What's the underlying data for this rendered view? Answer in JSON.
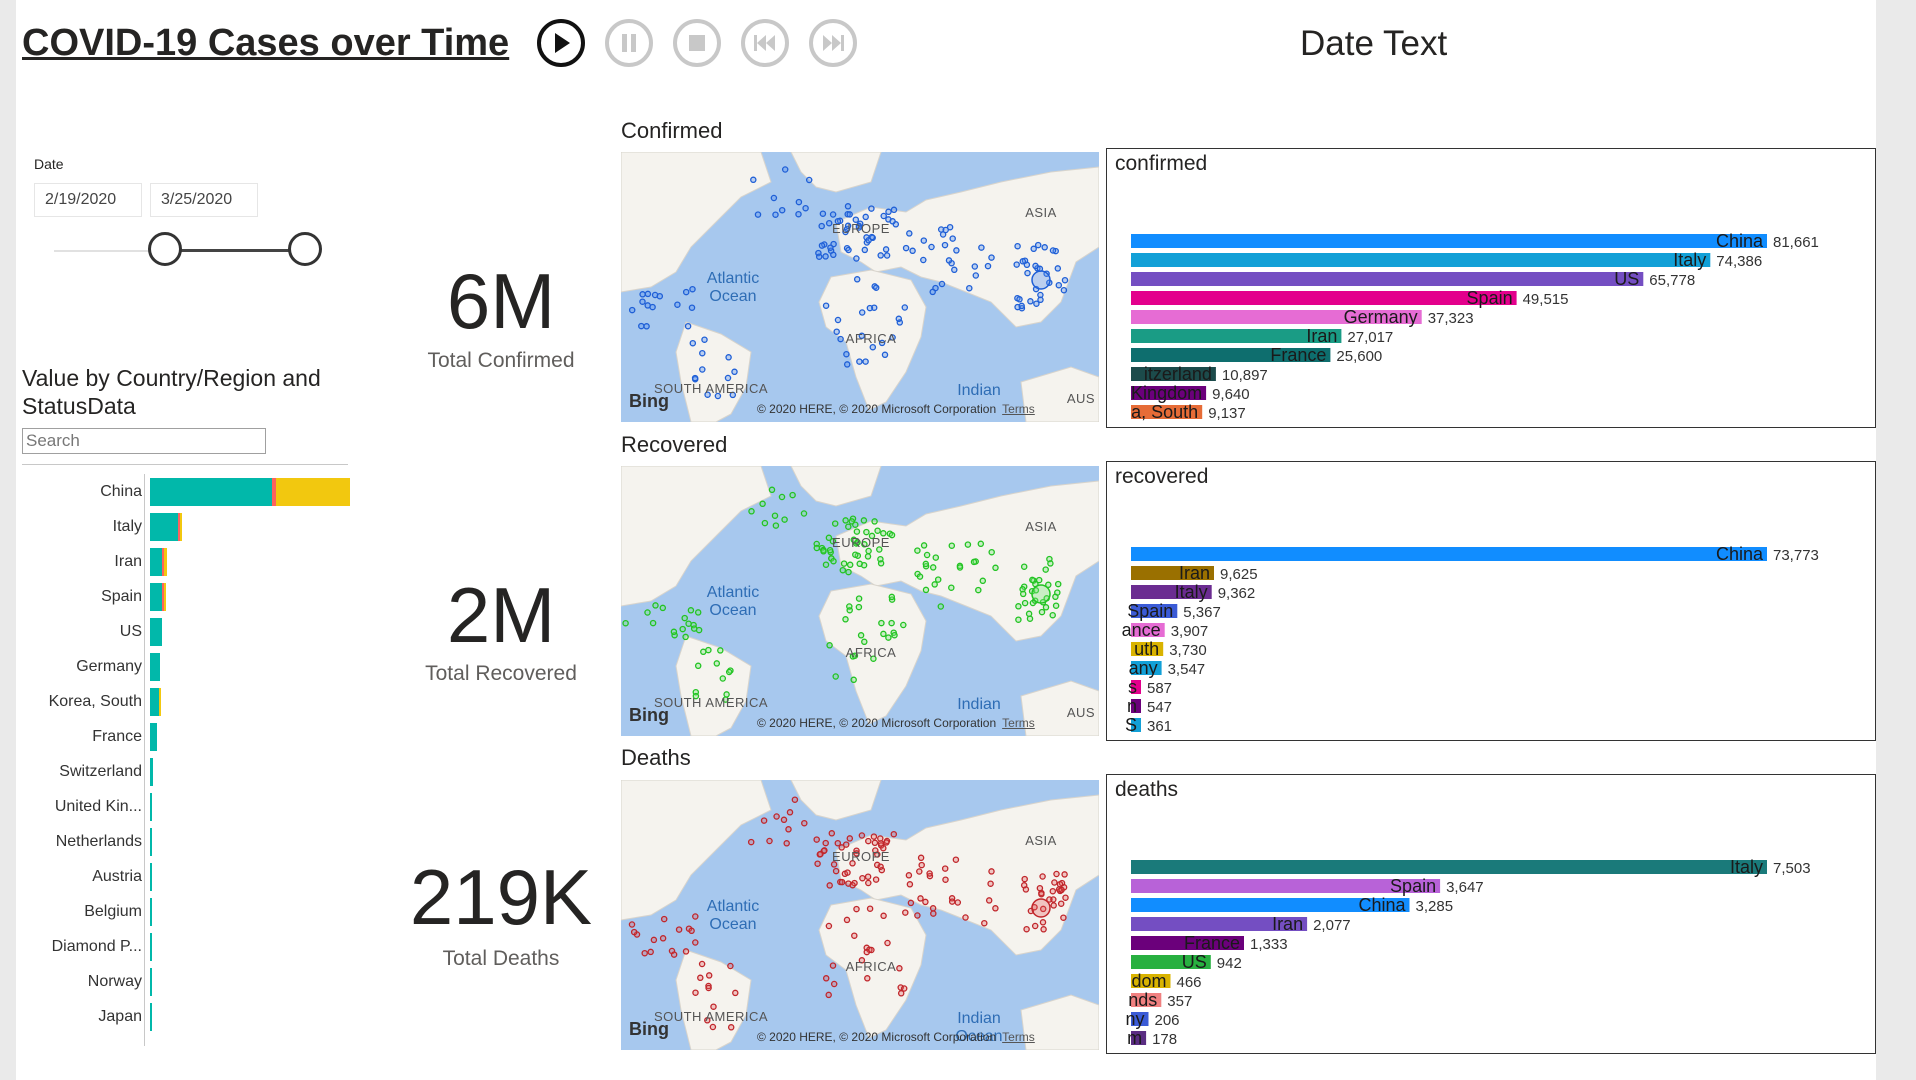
{
  "title": "COVID-19 Cases over Time",
  "date_text": "Date Text",
  "playback": {
    "buttons": [
      {
        "name": "play-button",
        "icon": "play-icon",
        "active": true
      },
      {
        "name": "pause-button",
        "icon": "pause-icon",
        "active": false
      },
      {
        "name": "stop-button",
        "icon": "stop-icon",
        "active": false
      },
      {
        "name": "previous-button",
        "icon": "previous-icon",
        "active": false
      },
      {
        "name": "next-button",
        "icon": "next-icon",
        "active": false
      }
    ]
  },
  "slicer": {
    "label": "Date",
    "start": "2/19/2020",
    "end": "3/25/2020"
  },
  "bar_visual": {
    "title": "Value by Country/Region and StatusData",
    "search_placeholder": "Search",
    "segment_colors": [
      "#01b8aa",
      "#fd625e",
      "#f2c80f"
    ],
    "rows": [
      {
        "label": "China",
        "segments": [
          0.61,
          0.02,
          0.37
        ]
      },
      {
        "label": "Italy",
        "segments": [
          0.14,
          0.01,
          0.01
        ]
      },
      {
        "label": "Iran",
        "segments": [
          0.06,
          0.005,
          0.015
        ]
      },
      {
        "label": "Spain",
        "segments": [
          0.06,
          0.005,
          0.005
        ]
      },
      {
        "label": "US",
        "segments": [
          0.06,
          0.0,
          0.0
        ]
      },
      {
        "label": "Germany",
        "segments": [
          0.05,
          0.0,
          0.0
        ]
      },
      {
        "label": "Korea, South",
        "segments": [
          0.045,
          0.0,
          0.005
        ]
      },
      {
        "label": "France",
        "segments": [
          0.035,
          0.0,
          0.0
        ]
      },
      {
        "label": "Switzerland",
        "segments": [
          0.015,
          0.0,
          0.0
        ]
      },
      {
        "label": "United Kin...",
        "segments": [
          0.012,
          0.0,
          0.0
        ]
      },
      {
        "label": "Netherlands",
        "segments": [
          0.01,
          0.0,
          0.0
        ]
      },
      {
        "label": "Austria",
        "segments": [
          0.01,
          0.0,
          0.0
        ]
      },
      {
        "label": "Belgium",
        "segments": [
          0.01,
          0.0,
          0.0
        ]
      },
      {
        "label": "Diamond P...",
        "segments": [
          0.008,
          0.0,
          0.0
        ]
      },
      {
        "label": "Norway",
        "segments": [
          0.008,
          0.0,
          0.0
        ]
      },
      {
        "label": "Japan",
        "segments": [
          0.008,
          0.0,
          0.0
        ]
      }
    ]
  },
  "kpis": [
    {
      "value": "6M",
      "label": "Total Confirmed"
    },
    {
      "value": "2M",
      "label": "Total Recovered"
    },
    {
      "value": "219K",
      "label": "Total Deaths"
    }
  ],
  "maps": [
    {
      "section": "Confirmed",
      "dot_color": "#1f5fd6",
      "dot_fill": "rgba(80,140,240,0.35)",
      "labels": {
        "ocean1": "Atlantic Ocean",
        "ocean2": "Indian",
        "c1": "EUROPE",
        "c2": "ASIA",
        "c3": "AFRICA",
        "c4": "SOUTH AMERICA",
        "c5": "AUS"
      }
    },
    {
      "section": "Recovered",
      "dot_color": "#22c322",
      "dot_fill": "rgba(120,230,120,0.35)",
      "labels": {
        "ocean1": "Atlantic Ocean",
        "ocean2": "Indian",
        "c1": "EUROPE",
        "c2": "ASIA",
        "c3": "AFRICA",
        "c4": "SOUTH AMERICA",
        "c5": "AUS"
      }
    },
    {
      "section": "Deaths",
      "dot_color": "#c0262b",
      "dot_fill": "rgba(230,90,90,0.3)",
      "labels": {
        "ocean1": "Atlantic Ocean",
        "ocean2": "Indian Ocean",
        "c1": "EUROPE",
        "c2": "ASIA",
        "c3": "AFRICA",
        "c4": "SOUTH AMERICA",
        "c5": ""
      }
    }
  ],
  "map_common": {
    "bing": "Bing",
    "credit": "© 2020 HERE, © 2020 Microsoft Corporation",
    "terms": "Terms"
  },
  "chart_data": [
    {
      "type": "bar",
      "title": "confirmed",
      "categories": [
        "China",
        "Italy",
        "US",
        "Spain",
        "Germany",
        "Iran",
        "France",
        "Switzerland",
        "United Kingdom",
        "Korea, South"
      ],
      "bar_labels": [
        "China",
        "Italy",
        "US",
        "Spain",
        "Germany",
        "Iran",
        "France",
        "itzerland",
        "Kingdom",
        "a, South"
      ],
      "values": [
        81661,
        74386,
        65778,
        49515,
        37323,
        27017,
        25600,
        10897,
        9640,
        9137
      ],
      "value_labels": [
        "81,661",
        "74,386",
        "65,778",
        "49,515",
        "37,323",
        "27,017",
        "25,600",
        "10,897",
        "9,640",
        "9,137"
      ],
      "colors": [
        "#118dff",
        "#12a0d7",
        "#744ec2",
        "#e3008c",
        "#e66cd4",
        "#1a9c85",
        "#0e6e6e",
        "#1c4b4b",
        "#6b007b",
        "#e66c37"
      ],
      "xlim": [
        0,
        81661
      ]
    },
    {
      "type": "bar",
      "title": "recovered",
      "categories": [
        "China",
        "Iran",
        "Italy",
        "Spain",
        "France",
        "Korea, South",
        "Germany",
        "US",
        "Japan",
        "Singapore"
      ],
      "bar_labels": [
        "China",
        "Iran",
        "Italy",
        "Spain",
        "ance",
        "uth",
        "any",
        "s",
        "n",
        "S"
      ],
      "values": [
        73773,
        9625,
        9362,
        5367,
        3907,
        3730,
        3547,
        587,
        547,
        361
      ],
      "value_labels": [
        "73,773",
        "9,625",
        "9,362",
        "5,367",
        "3,907",
        "3,730",
        "3,547",
        "587",
        "547",
        "361"
      ],
      "colors": [
        "#118dff",
        "#9a7000",
        "#6b2c91",
        "#3b5bd6",
        "#e66cd4",
        "#d9b300",
        "#12a0d7",
        "#e3008c",
        "#6b007b",
        "#12a0d7"
      ],
      "xlim": [
        0,
        73773
      ]
    },
    {
      "type": "bar",
      "title": "deaths",
      "categories": [
        "Italy",
        "Spain",
        "China",
        "Iran",
        "France",
        "US",
        "United Kingdom",
        "Netherlands",
        "Germany",
        "Belgium"
      ],
      "bar_labels": [
        "Italy",
        "Spain",
        "China",
        "Iran",
        "France",
        "US",
        "dom",
        "nds",
        "ny",
        "m"
      ],
      "values": [
        7503,
        3647,
        3285,
        2077,
        1333,
        942,
        466,
        357,
        206,
        178
      ],
      "value_labels": [
        "7,503",
        "3,647",
        "3,285",
        "2,077",
        "1,333",
        "942",
        "466",
        "357",
        "206",
        "178"
      ],
      "colors": [
        "#1a7a7a",
        "#b862d8",
        "#118dff",
        "#744ec2",
        "#6b007b",
        "#28b040",
        "#d9b300",
        "#f08080",
        "#3b5bd6",
        "#5a2d82"
      ],
      "xlim": [
        0,
        7503
      ]
    }
  ]
}
